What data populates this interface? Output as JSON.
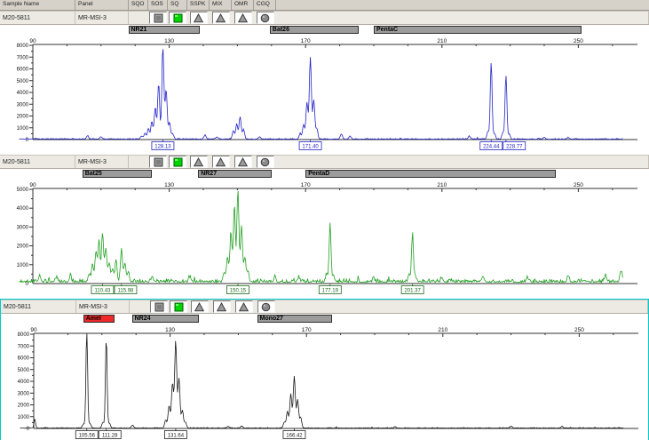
{
  "header": {
    "columns": [
      "Sample Name",
      "Panel",
      "SQO",
      "SOS",
      "SQ",
      "SSPK",
      "MIX",
      "OMR",
      "CGQ"
    ]
  },
  "colors": {
    "selection": "#00cdcd",
    "header_bg": "#d6d2ca",
    "row_bg": "#eceae3",
    "marker_gray": "#9c9c9c",
    "marker_red": "#ef2929",
    "flag_green": "#00d400",
    "flag_gray": "#9a9a9a"
  },
  "panels": [
    {
      "sample_name": "M20-5811",
      "panel_name": "MR-MSI-3",
      "selected": false,
      "dye_color": "#2323c8",
      "label_color": "#2323c8",
      "y_max": 8000,
      "y_ticks": [
        "1000",
        "2000",
        "3000",
        "4000",
        "5000",
        "6000",
        "7000",
        "8000"
      ],
      "x_ticks": [
        "90",
        "130",
        "170",
        "210",
        "250"
      ],
      "flags": [
        {
          "col": "SQO",
          "icon": "none"
        },
        {
          "col": "SOS",
          "icon": "square"
        },
        {
          "col": "SQ",
          "icon": "square-green"
        },
        {
          "col": "SSPK",
          "icon": "triangle"
        },
        {
          "col": "MIX",
          "icon": "triangle"
        },
        {
          "col": "OMR",
          "icon": "triangle"
        },
        {
          "col": "CGQ",
          "icon": "circle"
        }
      ],
      "markers": [
        {
          "label": "NR21",
          "start_bp": 118,
          "end_bp": 139,
          "style": "gray"
        },
        {
          "label": "Bat26",
          "start_bp": 159.5,
          "end_bp": 185.5,
          "style": "gray"
        },
        {
          "label": "PentaC",
          "start_bp": 190,
          "end_bp": 251,
          "style": "gray"
        }
      ],
      "peaks": [
        [
          121.9,
          250
        ],
        [
          122.9,
          500
        ],
        [
          123.9,
          900
        ],
        [
          124.9,
          1500
        ],
        [
          125.9,
          2700
        ],
        [
          126.9,
          4700
        ],
        [
          128.13,
          7800
        ],
        [
          129.1,
          4200
        ],
        [
          130.1,
          1400
        ],
        [
          131,
          450
        ],
        [
          148.8,
          700
        ],
        [
          149.8,
          1300
        ],
        [
          150.8,
          1900
        ],
        [
          151.8,
          800
        ],
        [
          168.4,
          450
        ],
        [
          169.4,
          1200
        ],
        [
          170.4,
          3100
        ],
        [
          171.4,
          6900
        ],
        [
          172.4,
          3300
        ],
        [
          173.3,
          900
        ],
        [
          223.5,
          650
        ],
        [
          224.44,
          6500,
          0.27
        ],
        [
          225.4,
          450
        ],
        [
          227.9,
          550
        ],
        [
          228.77,
          5400,
          0.27
        ],
        [
          229.7,
          400
        ],
        [
          106,
          280
        ],
        [
          110,
          200
        ],
        [
          140.5,
          350
        ],
        [
          144,
          180
        ],
        [
          156.5,
          200
        ],
        [
          180.5,
          420
        ],
        [
          183,
          250
        ],
        [
          218,
          260
        ],
        [
          240,
          150
        ],
        [
          247,
          120
        ]
      ],
      "peak_labels": [
        {
          "bp": 128.13,
          "text": "128.13"
        },
        {
          "bp": 171.4,
          "text": "171.40"
        },
        {
          "bp": 224.44,
          "text": "224.44"
        },
        {
          "bp": 228.77,
          "text": "228.77"
        }
      ],
      "noise_amp": 110,
      "seed": 7
    },
    {
      "sample_name": "M20-5811",
      "panel_name": "MR-MSI-3",
      "selected": false,
      "dye_color": "#22a022",
      "label_color": "#1c6a1c",
      "y_max": 5000,
      "y_ticks": [
        "1000",
        "2000",
        "3000",
        "4000",
        "5000"
      ],
      "x_ticks": [
        "90",
        "130",
        "170",
        "210",
        "250"
      ],
      "flags": [
        {
          "col": "SQO",
          "icon": "none"
        },
        {
          "col": "SOS",
          "icon": "square"
        },
        {
          "col": "SQ",
          "icon": "square-green"
        },
        {
          "col": "SSPK",
          "icon": "triangle"
        },
        {
          "col": "MIX",
          "icon": "triangle"
        },
        {
          "col": "OMR",
          "icon": "triangle"
        },
        {
          "col": "CGQ",
          "icon": "circle"
        }
      ],
      "markers": [
        {
          "label": "Bat25",
          "start_bp": 104.5,
          "end_bp": 125,
          "style": "gray"
        },
        {
          "label": "NR27",
          "start_bp": 138.5,
          "end_bp": 160,
          "style": "gray"
        },
        {
          "label": "PentaD",
          "start_bp": 170,
          "end_bp": 243.5,
          "style": "gray"
        }
      ],
      "peaks": [
        [
          106.5,
          400
        ],
        [
          107.5,
          900
        ],
        [
          108.5,
          1600
        ],
        [
          109.4,
          2200
        ],
        [
          110.43,
          2600
        ],
        [
          111.4,
          1800
        ],
        [
          112.4,
          1000
        ],
        [
          113.4,
          700
        ],
        [
          114.4,
          1200
        ],
        [
          115.98,
          1700
        ],
        [
          117,
          1000
        ],
        [
          118,
          500
        ],
        [
          146.1,
          500
        ],
        [
          147.1,
          1300
        ],
        [
          148.1,
          2600
        ],
        [
          149.1,
          4000
        ],
        [
          150.15,
          4900
        ],
        [
          151.2,
          3000
        ],
        [
          152.2,
          1300
        ],
        [
          153.1,
          500
        ],
        [
          176.2,
          400
        ],
        [
          177.19,
          3100,
          0.27
        ],
        [
          178.2,
          300
        ],
        [
          200.4,
          350
        ],
        [
          201.37,
          2600,
          0.27
        ],
        [
          202.3,
          250
        ],
        [
          92,
          350
        ],
        [
          97,
          250
        ],
        [
          101,
          300
        ],
        [
          125,
          300
        ],
        [
          136,
          250
        ],
        [
          161,
          300
        ],
        [
          168,
          250
        ],
        [
          190,
          200
        ],
        [
          210,
          250
        ],
        [
          222,
          300
        ],
        [
          235,
          250
        ],
        [
          247,
          300
        ],
        [
          258,
          350
        ],
        [
          262.5,
          600
        ]
      ],
      "peak_labels": [
        {
          "bp": 110.43,
          "text": "110.43"
        },
        {
          "bp": 115.98,
          "text": "115.98"
        },
        {
          "bp": 150.15,
          "text": "150.15"
        },
        {
          "bp": 177.19,
          "text": "177.19"
        },
        {
          "bp": 201.37,
          "text": "201.37"
        }
      ],
      "noise_amp": 280,
      "seed": 13
    },
    {
      "sample_name": "M20-5811",
      "panel_name": "MR-MSI-3",
      "selected": true,
      "dye_color": "#1a1a1a",
      "label_color": "#222222",
      "y_max": 8000,
      "y_ticks": [
        "1000",
        "2000",
        "3000",
        "4000",
        "5000",
        "6000",
        "7000",
        "8000"
      ],
      "x_ticks": [
        "90",
        "130",
        "170",
        "210",
        "250"
      ],
      "flags": [
        {
          "col": "SQO",
          "icon": "none"
        },
        {
          "col": "SOS",
          "icon": "square"
        },
        {
          "col": "SQ",
          "icon": "square-green"
        },
        {
          "col": "SSPK",
          "icon": "triangle"
        },
        {
          "col": "MIX",
          "icon": "triangle"
        },
        {
          "col": "OMR",
          "icon": "triangle"
        },
        {
          "col": "CGQ",
          "icon": "circle"
        }
      ],
      "markers": [
        {
          "label": "Amel",
          "start_bp": 104.5,
          "end_bp": 113.8,
          "style": "red"
        },
        {
          "label": "NR24",
          "start_bp": 118.8,
          "end_bp": 138.5,
          "style": "gray"
        },
        {
          "label": "Mono27",
          "start_bp": 155.5,
          "end_bp": 177.5,
          "style": "gray"
        }
      ],
      "peaks": [
        [
          90.3,
          800,
          0.22
        ],
        [
          104.6,
          350
        ],
        [
          105.56,
          8300,
          0.25
        ],
        [
          106.5,
          400
        ],
        [
          110.3,
          500
        ],
        [
          111.28,
          7600,
          0.25
        ],
        [
          112.2,
          400
        ],
        [
          128.7,
          700
        ],
        [
          129.7,
          1900
        ],
        [
          130.7,
          3800
        ],
        [
          131.64,
          7400
        ],
        [
          132.6,
          4200
        ],
        [
          133.6,
          1500
        ],
        [
          134.5,
          500
        ],
        [
          163.5,
          500
        ],
        [
          164.4,
          1400
        ],
        [
          165.4,
          2900
        ],
        [
          166.42,
          4400
        ],
        [
          167.4,
          2400
        ],
        [
          168.3,
          900
        ],
        [
          119,
          250
        ],
        [
          147,
          150
        ],
        [
          151,
          180
        ],
        [
          196,
          120
        ],
        [
          230,
          150
        ],
        [
          245,
          130
        ]
      ],
      "peak_labels": [
        {
          "bp": 105.56,
          "text": "105.56"
        },
        {
          "bp": 111.28,
          "text": "111.28"
        },
        {
          "bp": 131.64,
          "text": "131.64"
        },
        {
          "bp": 166.42,
          "text": "166.42"
        }
      ],
      "noise_amp": 80,
      "seed": 21
    }
  ]
}
